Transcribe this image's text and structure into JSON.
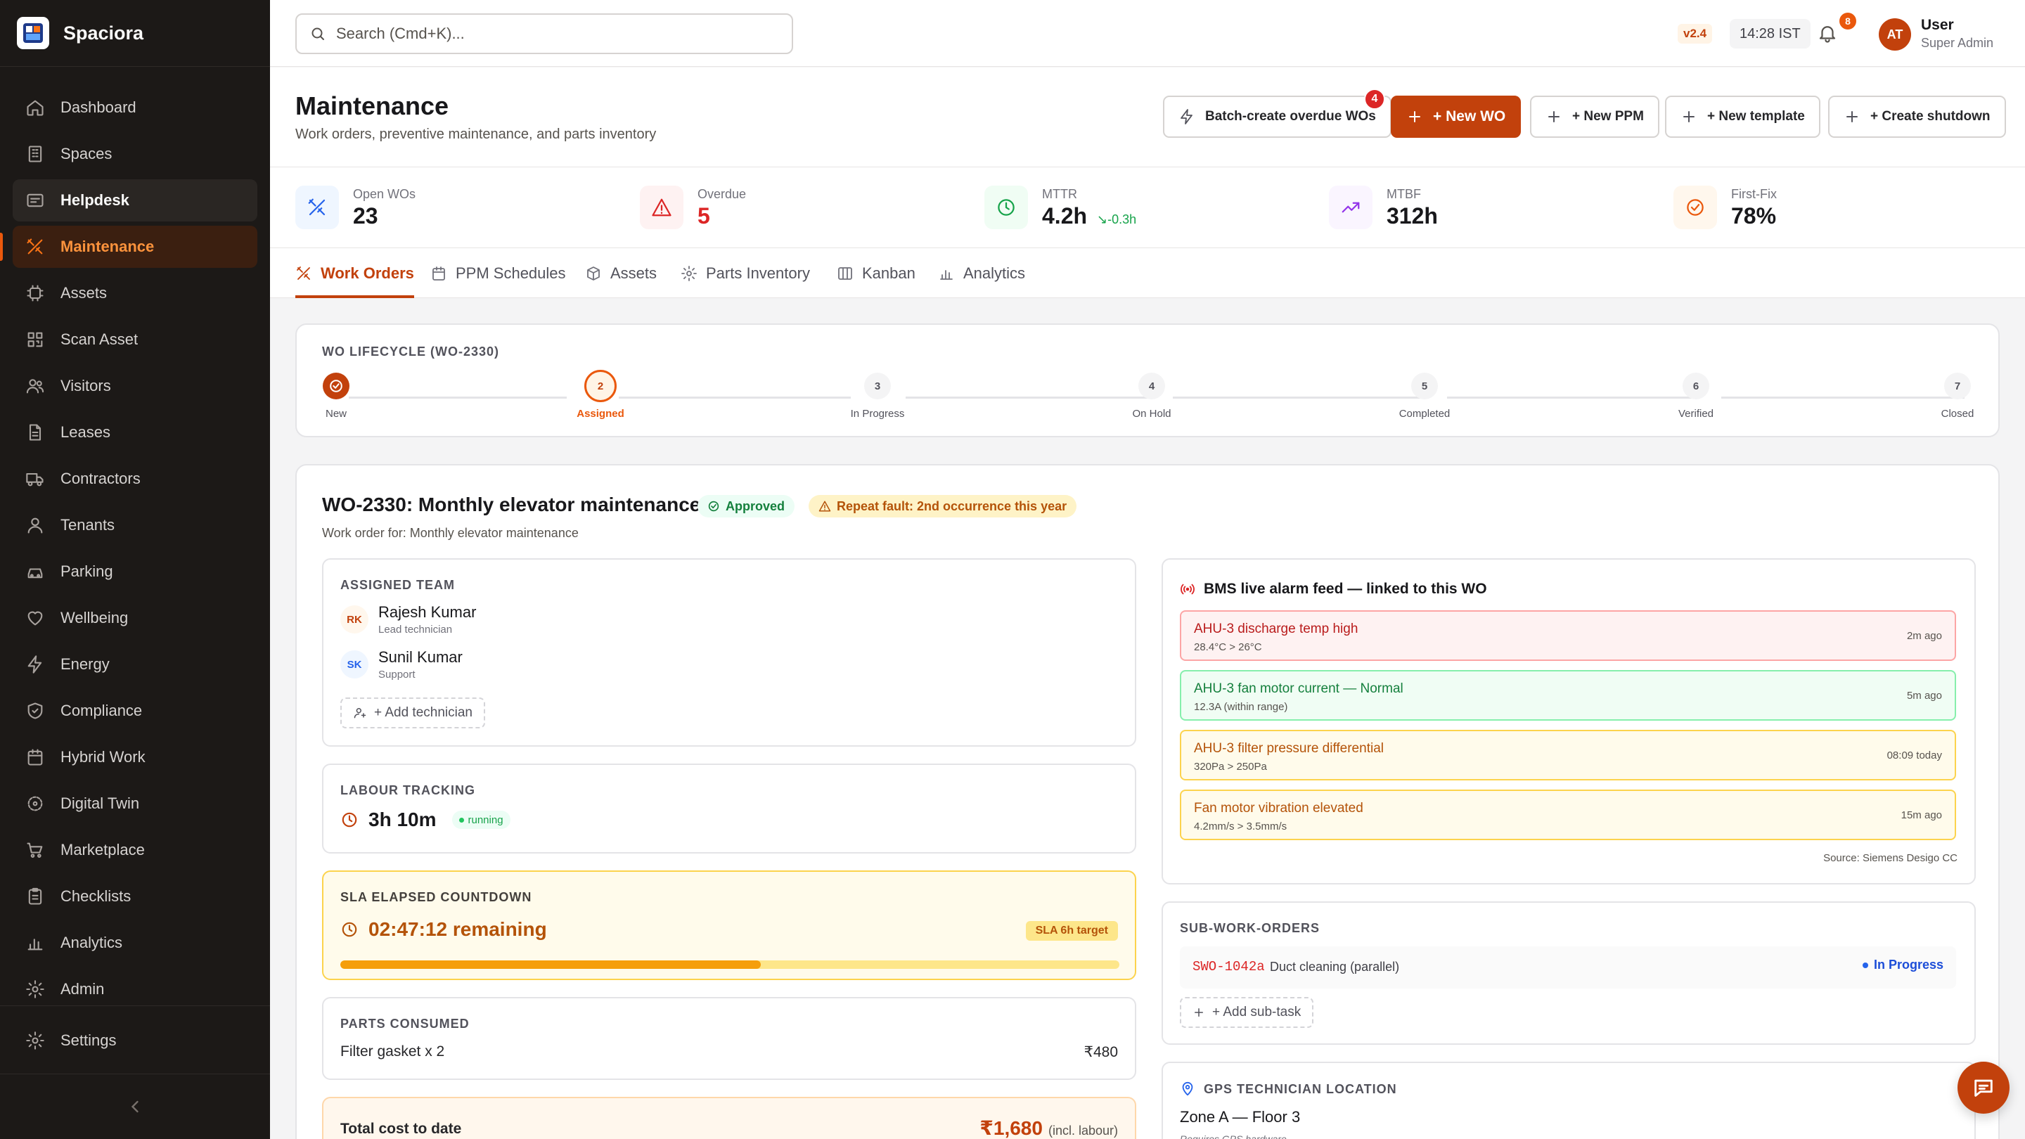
{
  "brand": {
    "name": "Spaciora"
  },
  "nav": {
    "items": [
      {
        "key": "dashboard",
        "label": "Dashboard",
        "icon": "home-icon"
      },
      {
        "key": "spaces",
        "label": "Spaces",
        "icon": "building-icon"
      },
      {
        "key": "helpdesk",
        "label": "Helpdesk",
        "icon": "inbox-icon"
      },
      {
        "key": "maintenance",
        "label": "Maintenance",
        "icon": "tools-icon"
      },
      {
        "key": "assets",
        "label": "Assets",
        "icon": "chip-icon"
      },
      {
        "key": "scan-asset",
        "label": "Scan Asset",
        "icon": "qr-icon"
      },
      {
        "key": "visitors",
        "label": "Visitors",
        "icon": "users-icon"
      },
      {
        "key": "leases",
        "label": "Leases",
        "icon": "document-icon"
      },
      {
        "key": "contractors",
        "label": "Contractors",
        "icon": "truck-icon"
      },
      {
        "key": "tenants",
        "label": "Tenants",
        "icon": "user-icon"
      },
      {
        "key": "parking",
        "label": "Parking",
        "icon": "car-icon"
      },
      {
        "key": "wellbeing",
        "label": "Wellbeing",
        "icon": "heart-icon"
      },
      {
        "key": "energy",
        "label": "Energy",
        "icon": "bolt-icon"
      },
      {
        "key": "compliance",
        "label": "Compliance",
        "icon": "shield-icon"
      },
      {
        "key": "hybrid-work",
        "label": "Hybrid Work",
        "icon": "calendar-icon"
      },
      {
        "key": "digital-twin",
        "label": "Digital Twin",
        "icon": "cube-icon"
      },
      {
        "key": "marketplace",
        "label": "Marketplace",
        "icon": "cart-icon"
      },
      {
        "key": "checklists",
        "label": "Checklists",
        "icon": "clipboard-icon"
      },
      {
        "key": "analytics",
        "label": "Analytics",
        "icon": "chart-icon"
      },
      {
        "key": "admin",
        "label": "Admin",
        "icon": "gear-icon"
      }
    ],
    "settings": {
      "label": "Settings",
      "icon": "gear-icon"
    }
  },
  "topbar": {
    "search_placeholder": "Search (Cmd+K)...",
    "version": "v2.4",
    "time": "14:28 IST",
    "notifications": "8",
    "user_initials": "AT",
    "user_name": "User",
    "user_role": "Super Admin"
  },
  "page": {
    "title": "Maintenance",
    "subtitle": "Work orders, preventive maintenance, and parts inventory",
    "actions": {
      "batch": "Batch-create overdue WOs",
      "batch_count": "4",
      "new_wo": "+ New WO",
      "new_ppm": "+ New PPM",
      "new_template": "+ New template",
      "shutdown": "+ Create shutdown"
    }
  },
  "kpis": [
    {
      "label": "Open WOs",
      "value": "23",
      "color": "#2563eb"
    },
    {
      "label": "Overdue",
      "value": "5",
      "color": "#dc2626"
    },
    {
      "label": "MTTR",
      "value": "4.2h",
      "delta": "-0.3h",
      "color": "#16a34a"
    },
    {
      "label": "MTBF",
      "value": "312h",
      "color": "#9333ea"
    },
    {
      "label": "First-Fix",
      "value": "78%",
      "color": "#ea580c"
    }
  ],
  "tabs": [
    {
      "label": "Work Orders",
      "active": true
    },
    {
      "label": "PPM Schedules"
    },
    {
      "label": "Assets"
    },
    {
      "label": "Parts Inventory"
    },
    {
      "label": "Kanban"
    },
    {
      "label": "Analytics"
    }
  ],
  "lifecycle": {
    "title": "WO Lifecycle (WO-2330)",
    "steps": [
      {
        "num": "1",
        "label": "New",
        "state": "done"
      },
      {
        "num": "2",
        "label": "Assigned",
        "state": "current"
      },
      {
        "num": "3",
        "label": "In Progress",
        "state": "pending"
      },
      {
        "num": "4",
        "label": "On Hold",
        "state": "pending"
      },
      {
        "num": "5",
        "label": "Completed",
        "state": "pending"
      },
      {
        "num": "6",
        "label": "Verified",
        "state": "pending"
      },
      {
        "num": "7",
        "label": "Closed",
        "state": "pending"
      }
    ]
  },
  "wo": {
    "title": "WO-2330: Monthly elevator maintenance",
    "status": "Approved",
    "repeat": "Repeat fault: 2nd occurrence this year",
    "subtitle": "Work order for: Monthly elevator maintenance",
    "team": {
      "title": "Assigned Team",
      "members": [
        {
          "initials": "RK",
          "name": "Rajesh Kumar",
          "role": "Lead technician"
        },
        {
          "initials": "SK",
          "name": "Sunil Kumar",
          "role": "Support"
        }
      ],
      "add_label": "+ Add technician"
    },
    "labour": {
      "title": "Labour Tracking",
      "time": "3h 10m",
      "status": "running"
    },
    "sla": {
      "title": "SLA Elapsed Countdown",
      "remaining": "02:47:12 remaining",
      "target": "SLA 6h target",
      "progress": 0.54
    },
    "parts": {
      "title": "Parts Consumed",
      "items": [
        {
          "name": "Filter gasket x 2",
          "cost": "₹480"
        }
      ]
    },
    "total": {
      "label": "Total cost to date",
      "value": "₹1,680",
      "note": "(incl. labour)"
    },
    "bms": {
      "title": "BMS live alarm feed — linked to this WO",
      "alarms": [
        {
          "title": "AHU-3 discharge temp high",
          "detail": "28.4°C > 26°C",
          "time": "2m ago",
          "severity": "critical"
        },
        {
          "title": "AHU-3 fan motor current — Normal",
          "detail": "12.3A (within range)",
          "time": "5m ago",
          "severity": "normal"
        },
        {
          "title": "AHU-3 filter pressure differential",
          "detail": "320Pa > 250Pa",
          "time": "08:09 today",
          "severity": "warning"
        },
        {
          "title": "Fan motor vibration elevated",
          "detail": "4.2mm/s > 3.5mm/s",
          "time": "15m ago",
          "severity": "warning"
        }
      ],
      "source": "Source: Siemens Desigo CC"
    },
    "subwo": {
      "title": "Sub-Work-Orders",
      "items": [
        {
          "id": "SWO-1042a",
          "desc": "Duct cleaning (parallel)",
          "status": "In Progress"
        }
      ],
      "add_label": "+ Add sub-task"
    },
    "gps": {
      "title": "GPS Technician Location",
      "zone": "Zone A — Floor 3",
      "note": "Requires GPS hardware"
    }
  },
  "colors": {
    "accent": "#c2410c",
    "sidebar": "#1c1917"
  }
}
